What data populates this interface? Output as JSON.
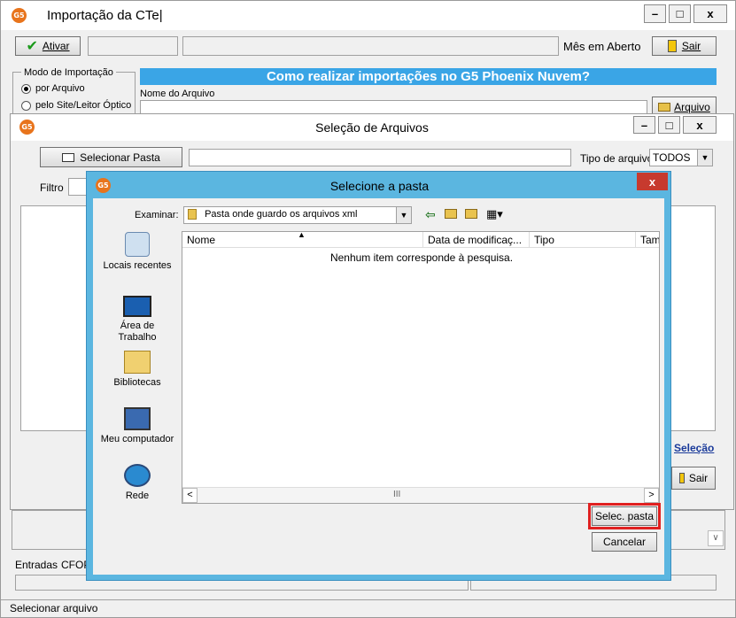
{
  "main_window": {
    "title": "Importação da CTe|",
    "controls": [
      "–",
      "□",
      "x"
    ],
    "toolbar": {
      "ativar_label": "Ativar",
      "status_text": "Mês em Aberto",
      "sair_label": "Sair"
    },
    "modo_importacao": {
      "legend": "Modo de Importação",
      "options": [
        "por Arquivo",
        "pelo Site/Leitor Óptico"
      ],
      "selected": "por Arquivo"
    },
    "banner": "Como realizar importações no G5 Phoenix Nuvem?",
    "file_name_label": "Nome do Arquivo",
    "file_button_label": "Arquivo",
    "entradas_label": "Entradas",
    "cfop_label": "CFOP",
    "status_bar": "Selecionar arquivo"
  },
  "selecao_window": {
    "title": "Seleção de Arquivos",
    "controls": [
      "–",
      "□",
      "x"
    ],
    "selecionar_pasta_label": "Selecionar Pasta",
    "tipo_arquivo_label": "Tipo de arquivo",
    "tipo_arquivo_value": "TODOS",
    "filtro_label": "Filtro",
    "selecao_link": "Seleção",
    "sair_label": "Sair"
  },
  "folder_dialog": {
    "title": "Selecione a pasta",
    "close_label": "x",
    "examinar_label": "Examinar:",
    "examinar_value": "Pasta onde guardo os arquivos xml",
    "places": [
      {
        "label": "Locais recentes",
        "icon": "recent-places-icon"
      },
      {
        "label": "Área de Trabalho",
        "icon": "desktop-icon"
      },
      {
        "label": "Bibliotecas",
        "icon": "libraries-icon"
      },
      {
        "label": "Meu computador",
        "icon": "computer-icon"
      },
      {
        "label": "Rede",
        "icon": "network-icon"
      }
    ],
    "columns": [
      "Nome",
      "Data de modificaç...",
      "Tipo",
      "Tam"
    ],
    "empty_message": "Nenhum item corresponde à pesquisa.",
    "select_button": "Selec. pasta",
    "cancel_button": "Cancelar",
    "highlight_color": "#e02020",
    "frame_color": "#5bb6e0"
  }
}
